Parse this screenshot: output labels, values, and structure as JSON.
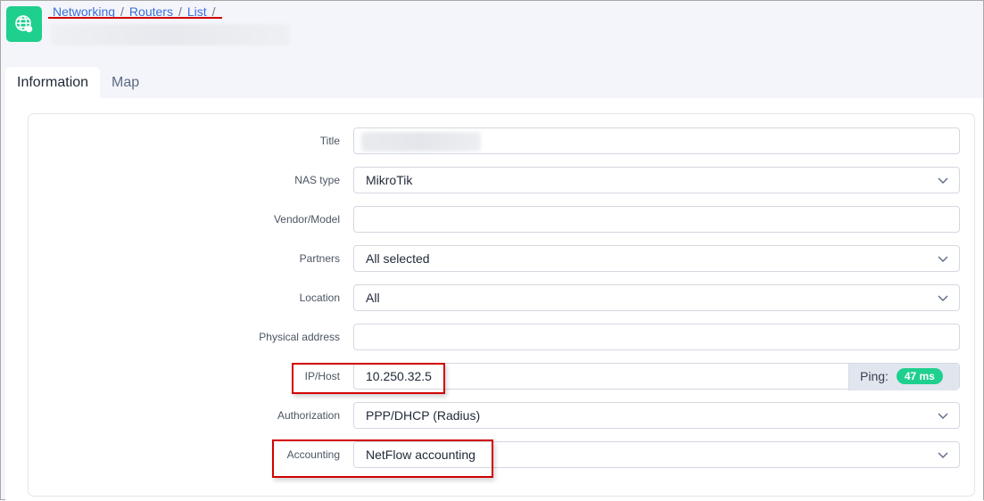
{
  "header": {
    "app_icon": "globe-icon",
    "breadcrumb": [
      {
        "label": "Networking"
      },
      {
        "label": "Routers"
      },
      {
        "label": "List"
      }
    ],
    "breadcrumb_separator": "/"
  },
  "tabs": [
    {
      "label": "Information",
      "active": true
    },
    {
      "label": "Map",
      "active": false
    }
  ],
  "form": {
    "title": {
      "label": "Title",
      "value": ""
    },
    "nas_type": {
      "label": "NAS type",
      "value": "MikroTik"
    },
    "vendor_model": {
      "label": "Vendor/Model",
      "value": ""
    },
    "partners": {
      "label": "Partners",
      "value": "All selected"
    },
    "location": {
      "label": "Location",
      "value": "All"
    },
    "physical_address": {
      "label": "Physical address",
      "value": ""
    },
    "ip_host": {
      "label": "IP/Host",
      "value": "10.250.32.5",
      "ping_label": "Ping:",
      "ping_value": "47 ms"
    },
    "authorization": {
      "label": "Authorization",
      "value": "PPP/DHCP (Radius)"
    },
    "accounting": {
      "label": "Accounting",
      "value": "NetFlow accounting"
    }
  },
  "colors": {
    "accent": "#1fcf8e",
    "link": "#3a6ddb",
    "annotation": "#d10000"
  }
}
